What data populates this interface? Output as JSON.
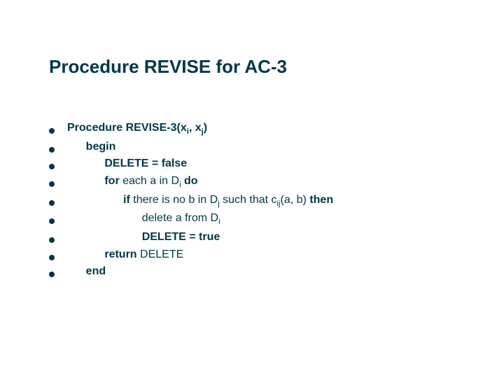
{
  "title": "Procedure REVISE for AC-3",
  "lines": [
    {
      "indent": 0,
      "segments": [
        {
          "t": "Procedure REVISE-3(x",
          "b": true
        },
        {
          "t": "i",
          "b": true,
          "sub": true
        },
        {
          "t": ", x",
          "b": true
        },
        {
          "t": "j",
          "b": true,
          "sub": true
        },
        {
          "t": ")",
          "b": true
        }
      ]
    },
    {
      "indent": 1,
      "segments": [
        {
          "t": "begin",
          "b": true
        }
      ]
    },
    {
      "indent": 2,
      "segments": [
        {
          "t": "DELETE = false",
          "b": true
        }
      ]
    },
    {
      "indent": 2,
      "segments": [
        {
          "t": "for",
          "b": true
        },
        {
          "t": " each a in D",
          "b": false
        },
        {
          "t": "i",
          "b": false,
          "sub": true
        },
        {
          "t": " ",
          "b": false
        },
        {
          "t": "do",
          "b": true
        }
      ]
    },
    {
      "indent": 3,
      "segments": [
        {
          "t": "if",
          "b": true
        },
        {
          "t": " there is no b in D",
          "b": false
        },
        {
          "t": "j",
          "b": false,
          "sub": true
        },
        {
          "t": " such that c",
          "b": false
        },
        {
          "t": "ij",
          "b": false,
          "sub": true
        },
        {
          "t": "(a, b) ",
          "b": false
        },
        {
          "t": "then",
          "b": true
        }
      ]
    },
    {
      "indent": 4,
      "segments": [
        {
          "t": "delete a from D",
          "b": false
        },
        {
          "t": "i",
          "b": false,
          "sub": true
        }
      ]
    },
    {
      "indent": 4,
      "segments": [
        {
          "t": "DELETE = true",
          "b": true
        }
      ]
    },
    {
      "indent": 2,
      "segments": [
        {
          "t": "return",
          "b": true
        },
        {
          "t": " DELETE",
          "b": false
        }
      ]
    },
    {
      "indent": 1,
      "segments": [
        {
          "t": "end",
          "b": true
        }
      ]
    }
  ],
  "indentUnit": "      "
}
